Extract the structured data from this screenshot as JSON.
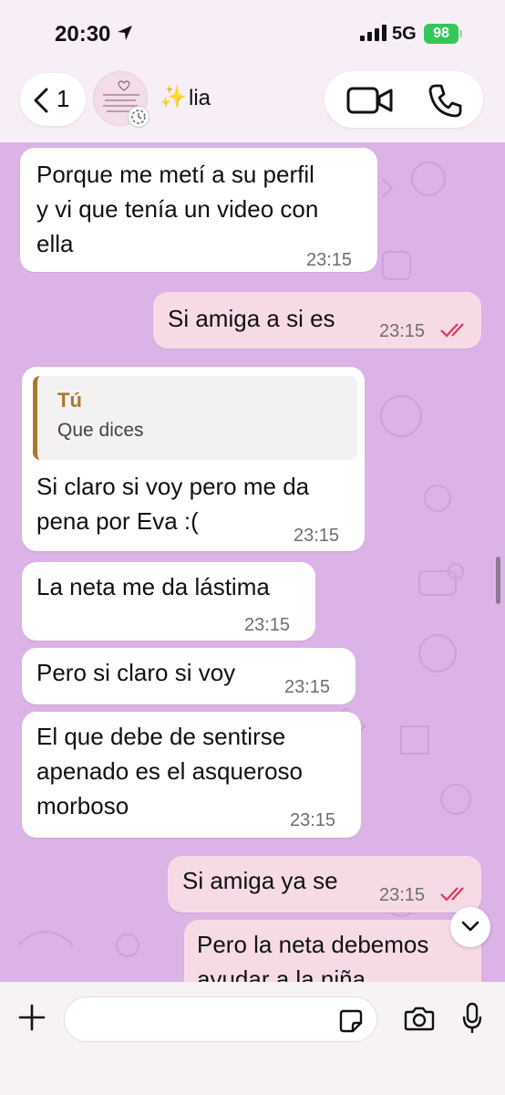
{
  "status_bar": {
    "time": "20:30",
    "network": "5G",
    "battery": "98"
  },
  "header": {
    "back_count": "1",
    "contact_emoji": "✨",
    "contact_name": "lia"
  },
  "messages": [
    {
      "direction": "in",
      "text_lines": [
        "Porque me metí a su perfil",
        "y vi que tenía un video con",
        "ella"
      ],
      "time": "23:15"
    },
    {
      "direction": "out",
      "text_lines": [
        "Si amiga a si es"
      ],
      "time": "23:15",
      "status": "read"
    },
    {
      "direction": "in",
      "quote": {
        "author": "Tú",
        "text": "Que dices"
      },
      "text_lines": [
        "Si claro si voy pero me da",
        "pena por Eva :("
      ],
      "time": "23:15"
    },
    {
      "direction": "in",
      "text_lines": [
        "La neta me da lástima"
      ],
      "time": "23:15"
    },
    {
      "direction": "in",
      "text_lines": [
        "Pero si claro si voy"
      ],
      "time": "23:15"
    },
    {
      "direction": "in",
      "text_lines": [
        "El que debe de sentirse",
        "apenado es el asqueroso",
        "morboso"
      ],
      "time": "23:15"
    },
    {
      "direction": "out",
      "text_lines": [
        "Si amiga ya se"
      ],
      "time": "23:15",
      "status": "read"
    },
    {
      "direction": "out",
      "text_lines": [
        "Pero la neta debemos",
        "ayudar a la niña"
      ],
      "time": ""
    }
  ],
  "colors": {
    "chat_background": "#dcb3e6",
    "incoming_bubble": "#ffffff",
    "outgoing_bubble": "#f6dbe6",
    "read_ticks": "#e0365a",
    "quote_accent": "#a8792a",
    "battery": "#34c759"
  },
  "icons": {
    "back": "chevron-left-icon",
    "video": "video-camera-icon",
    "phone": "phone-icon",
    "plus": "plus-icon",
    "sticker": "sticker-icon",
    "camera": "camera-icon",
    "mic": "microphone-icon",
    "scroll": "chevron-down-icon"
  }
}
